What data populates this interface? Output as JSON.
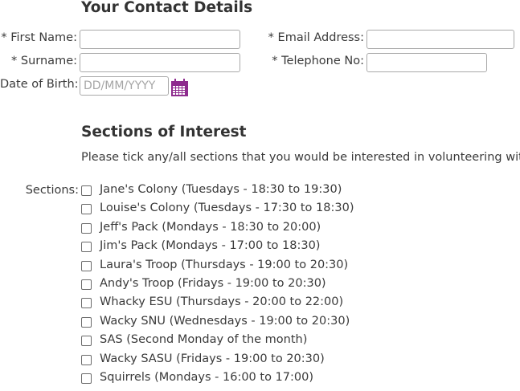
{
  "contact": {
    "heading": "Your Contact Details",
    "first_name_label": "* First Name:",
    "first_name_value": "",
    "surname_label": "* Surname:",
    "surname_value": "",
    "dob_label": "Date of Birth:",
    "dob_placeholder": "DD/MM/YYYY",
    "email_label": "* Email Address:",
    "email_value": "",
    "phone_label": "* Telephone No:",
    "phone_value": ""
  },
  "sections": {
    "heading": "Sections of Interest",
    "description": "Please tick any/all sections that you would be interested in volunteering with.",
    "label": "Sections:",
    "items": [
      {
        "label": "Jane's Colony (Tuesdays - 18:30 to 19:30)",
        "checked": false
      },
      {
        "label": "Louise's Colony (Tuesdays - 17:30 to 18:30)",
        "checked": false
      },
      {
        "label": "Jeff's Pack (Mondays - 18:30 to 20:00)",
        "checked": false
      },
      {
        "label": "Jim's Pack (Mondays - 17:00 to 18:30)",
        "checked": false
      },
      {
        "label": "Laura's Troop (Thursdays - 19:00 to 20:30)",
        "checked": false
      },
      {
        "label": "Andy's Troop (Fridays - 19:00 to 20:30)",
        "checked": false
      },
      {
        "label": "Whacky ESU (Thursdays - 20:00 to 22:00)",
        "checked": false
      },
      {
        "label": "Wacky SNU (Wednesdays - 19:00 to 20:30)",
        "checked": false
      },
      {
        "label": "SAS (Second Monday of the month)",
        "checked": false
      },
      {
        "label": "Wacky SASU (Fridays - 19:00 to 20:30)",
        "checked": false
      },
      {
        "label": "Squirrels (Mondays - 16:00 to 17:00)",
        "checked": false
      }
    ]
  },
  "colors": {
    "calendar_icon": "#8e2c8e",
    "text": "#3a3a3a",
    "input_border": "#a9a9a9"
  },
  "icons": {
    "calendar": "calendar-icon"
  }
}
